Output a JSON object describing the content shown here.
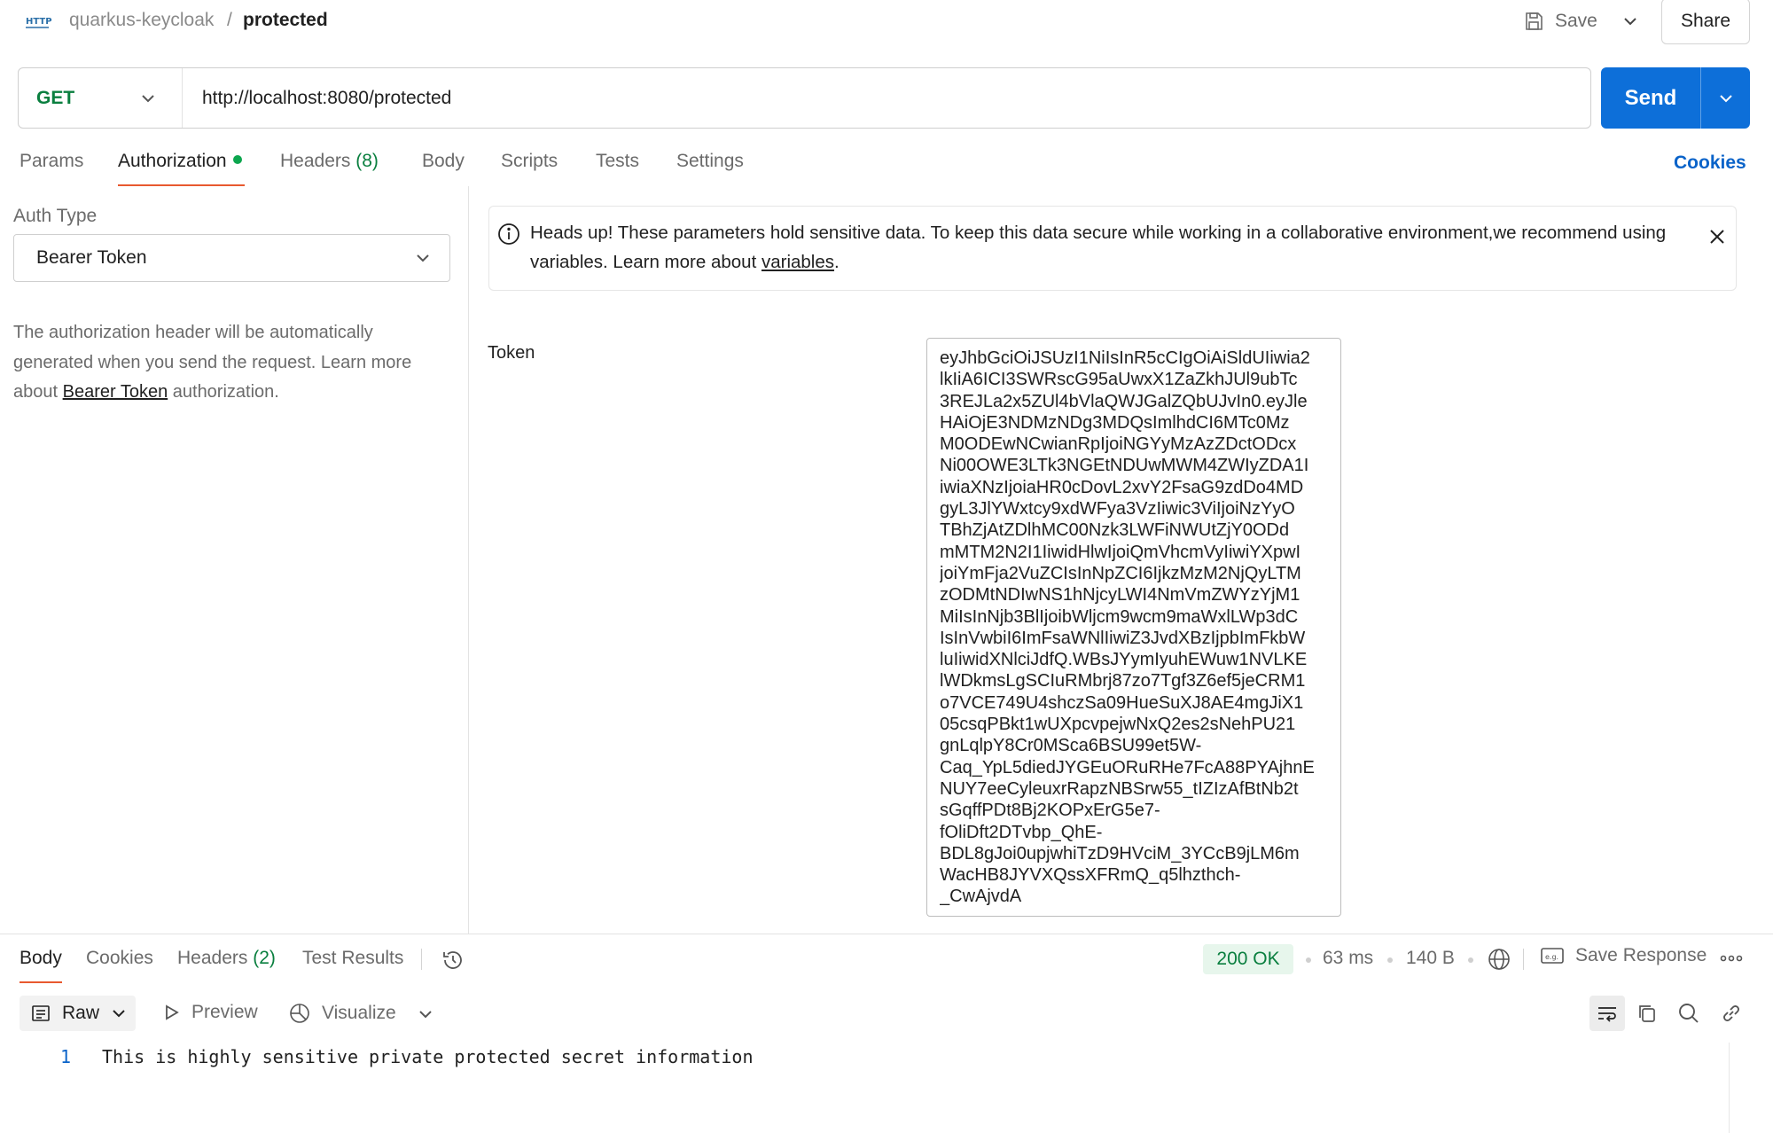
{
  "header": {
    "icon": "http-icon",
    "collection": "quarkus-keycloak",
    "separator": "/",
    "request_name": "protected",
    "save_label": "Save",
    "share_label": "Share"
  },
  "request": {
    "method": "GET",
    "url": "http://localhost:8080/protected",
    "send_label": "Send"
  },
  "tabs": {
    "params": "Params",
    "authorization": "Authorization",
    "headers": "Headers",
    "headers_count": "(8)",
    "body": "Body",
    "scripts": "Scripts",
    "tests": "Tests",
    "settings": "Settings",
    "cookies": "Cookies",
    "active": "Authorization"
  },
  "auth": {
    "type_label": "Auth Type",
    "type_value": "Bearer Token",
    "help_prefix": "The authorization header will be automatically generated when you send the request. Learn more about ",
    "help_link": "Bearer Token",
    "help_suffix": " authorization."
  },
  "notice": {
    "text": "Heads up! These parameters hold sensitive data. To keep this data secure while working in a collaborative environment,we recommend using variables. Learn more about ",
    "link": "variables",
    "suffix": "."
  },
  "token": {
    "label": "Token",
    "lines": [
      "eyJhbGciOiJSUzI1NiIsInR5cCIgOiAiSldUIiwia2",
      "lkIiA6ICI3SWRscG95aUwxX1ZaZkhJUl9ubTc",
      "3REJLa2x5ZUl4bVlaQWJGalZQbUJvIn0.eyJle",
      "HAiOjE3NDMzNDg3MDQsImlhdCI6MTc0Mz",
      "M0ODEwNCwianRpIjoiNGYyMzAzZDctODcx",
      "Ni00OWE3LTk3NGEtNDUwMWM4ZWIyZDA1I",
      "iwiaXNzIjoiaHR0cDovL2xvY2FsaG9zdDo4MD",
      "gyL3JlYWxtcy9xdWFya3VzIiwic3ViIjoiNzYyO",
      "TBhZjAtZDlhMC00Nzk3LWFiNWUtZjY0ODd",
      "mMTM2N2I1IiwidHlwIjoiQmVhcmVyIiwiYXpwI",
      "joiYmFja2VuZCIsInNpZCI6IjkzMzM2NjQyLTM",
      "zODMtNDIwNS1hNjcyLWI4NmVmZWYzYjM1",
      "MiIsInNjb3BlIjoibWljcm9wcm9maWxlLWp3dC",
      "IsInVwbiI6ImFsaWNlIiwiZ3JvdXBzIjpbImFkbW",
      "luIiwidXNlciJdfQ.WBsJYymIyuhEWuw1NVLKE",
      "lWDkmsLgSCIuRMbrj87zo7Tgf3Z6ef5jeCRM1",
      "o7VCE749U4shczSa09HueSuXJ8AE4mgJiX1",
      "05csqPBkt1wUXpcvpejwNxQ2es2sNehPU21",
      "gnLqlpY8Cr0MSca6BSU99et5W-",
      "Caq_YpL5diedJYGEuORuRHe7FcA88PYAjhnE",
      "NUY7eeCyleuxrRapzNBSrw55_tIZIzAfBtNb2t",
      "sGqffPDt8Bj2KOPxErG5e7-",
      "fOliDft2DTvbp_QhE-",
      "BDL8gJoi0upjwhiTzD9HVciM_3YCcB9jLM6m",
      "WacHB8JYVXQssXFRmQ_q5lhzthch-",
      "_CwAjvdA"
    ]
  },
  "response": {
    "tabs": {
      "body": "Body",
      "cookies": "Cookies",
      "headers": "Headers",
      "headers_count": "(2)",
      "test_results": "Test Results"
    },
    "status": "200 OK",
    "time": "63 ms",
    "size": "140 B",
    "save_response": "Save Response",
    "view": {
      "raw": "Raw",
      "preview": "Preview",
      "visualize": "Visualize"
    },
    "line_number": "1",
    "body_text": "This is highly sensitive private protected secret information"
  },
  "colors": {
    "accent": "#0d6fd9",
    "method_green": "#0a7f3f",
    "tab_underline": "#e8592f",
    "status_bg": "#e7f6ec"
  }
}
